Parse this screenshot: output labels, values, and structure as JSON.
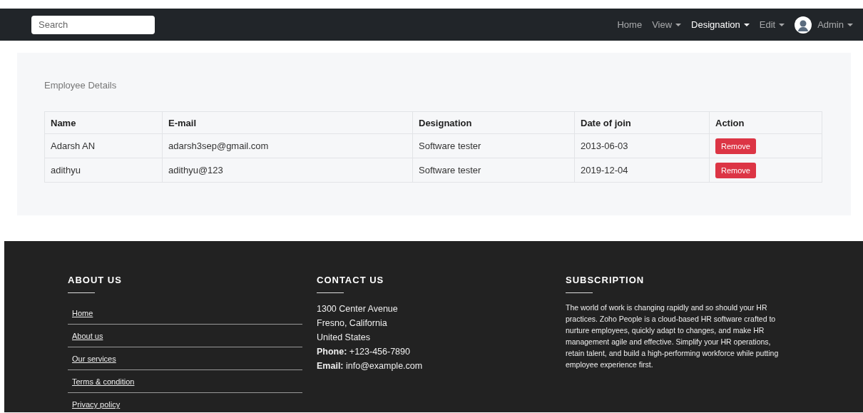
{
  "navbar": {
    "search": {
      "placeholder": "Search"
    },
    "items": [
      {
        "label": "Home",
        "selected": false,
        "dropdown": false
      },
      {
        "label": "View",
        "selected": false,
        "dropdown": true
      },
      {
        "label": "Designation",
        "selected": true,
        "dropdown": true
      },
      {
        "label": "Edit",
        "selected": false,
        "dropdown": true
      }
    ],
    "user": {
      "label": "Admin",
      "dropdown": true
    }
  },
  "card": {
    "title": "Employee Details",
    "table": {
      "columns": [
        "Name",
        "E-mail",
        "Designation",
        "Date of join",
        "Action"
      ],
      "rows": [
        {
          "cells": [
            "Adarsh AN",
            "adarsh3sep@gmail.com",
            "Software tester",
            "2013-06-03"
          ],
          "action": "Remove"
        },
        {
          "cells": [
            "adithyu",
            "adithyu@123",
            "Software tester",
            "2019-12-04"
          ],
          "action": "Remove"
        }
      ]
    }
  },
  "footer": {
    "about": {
      "heading": "ABOUT US",
      "links": [
        "Home",
        "About us",
        "Our services",
        "Terms & condition",
        "Privacy policy"
      ]
    },
    "contact": {
      "heading": "CONTACT US",
      "lines": [
        "1300 Center Avenue",
        "Fresno, California",
        "United States",
        "**Phone:** +123-456-7890",
        "**Email:** info@example.com"
      ]
    },
    "subscription": {
      "heading": "SUBSCRIPTION",
      "text": "The world of work is changing rapidly and so should your HR practices. Zoho People is a cloud-based HR software crafted to nurture employees, quickly adapt to changes, and make HR management agile and effective. Simplify your HR operations, retain talent, and build a high-performing workforce while putting employee experience first."
    }
  }
}
